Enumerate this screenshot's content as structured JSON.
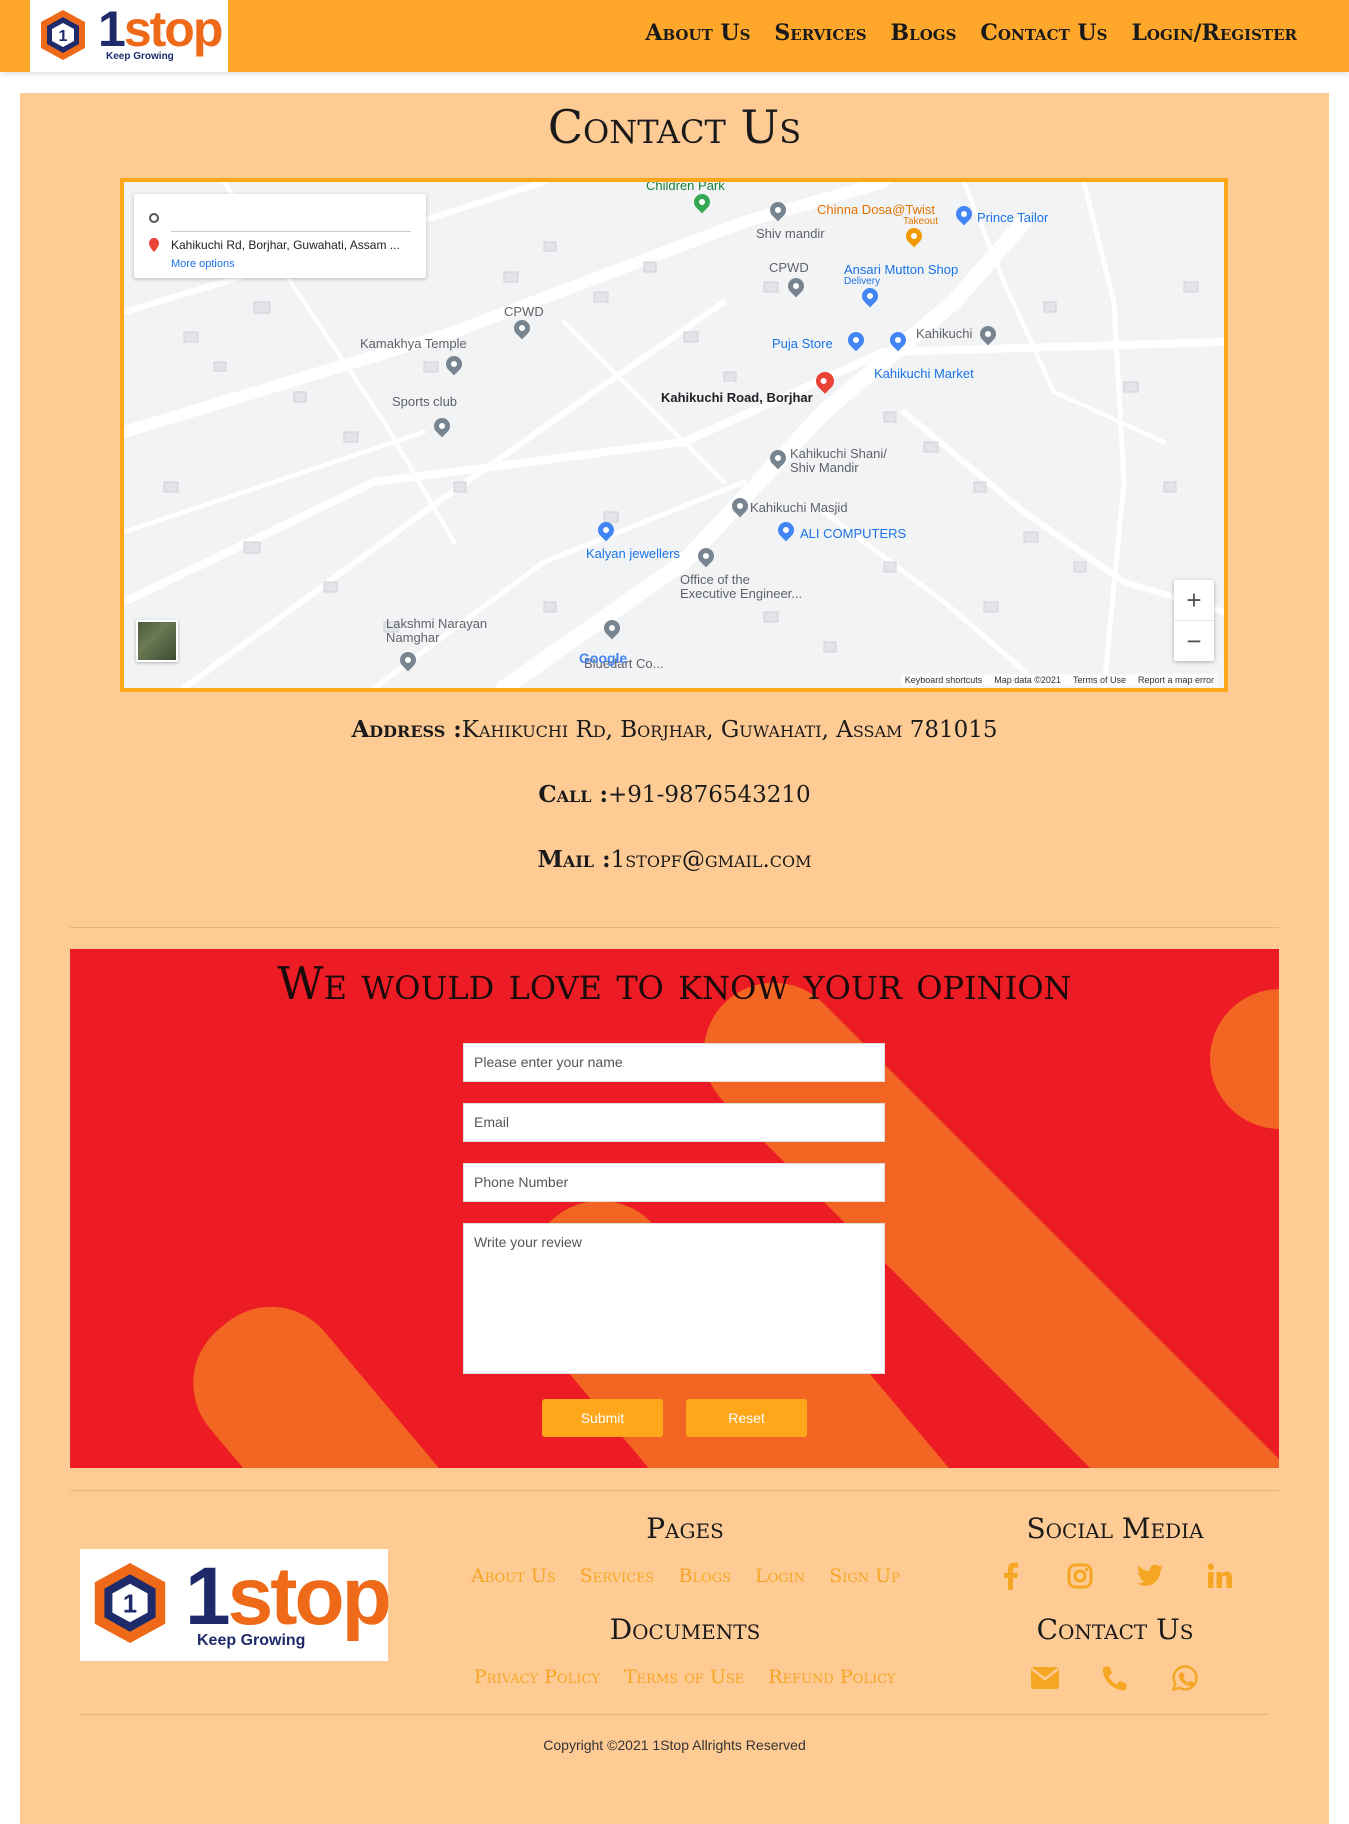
{
  "header": {
    "logo_text": "1stop",
    "logo_tagline": "Keep Growing",
    "nav": [
      "About Us",
      "Services",
      "Blogs",
      "Contact Us",
      "Login/Register"
    ]
  },
  "page_title": "Contact Us",
  "map": {
    "card_address": "Kahikuchi Rd, Borjhar, Guwahati, Assam ...",
    "card_more": "More options",
    "pin_label": "Kahikuchi Road, Borjhar",
    "places": [
      "Children Park",
      "Shiv mandir",
      "Chinna Dosa@Twist",
      "Takeout",
      "Prince Tailor",
      "CPWD",
      "Ansari Mutton Shop",
      "Delivery",
      "CPWD",
      "Kamakhya Temple",
      "Puja Store",
      "Kahikuchi",
      "Kahikuchi Market",
      "Sports club",
      "Kahikuchi Shani/",
      "Shiv Mandir",
      "Kahikuchi Masjid",
      "ALI COMPUTERS",
      "Kalyan jewellers",
      "Office of the",
      "Executive Engineer...",
      "Lakshmi Narayan",
      "Namghar",
      "Bluedart Co..."
    ],
    "google": "Google",
    "footer": [
      "Keyboard shortcuts",
      "Map data ©2021",
      "Terms of Use",
      "Report a map error"
    ],
    "zoom_in": "+",
    "zoom_out": "−"
  },
  "contact": {
    "address_label": "Address :",
    "address": "Kahikuchi Rd, Borjhar, Guwahati, Assam 781015",
    "call_label": "Call :",
    "call": "+91-9876543210",
    "mail_label": "Mail :",
    "mail": "1stopf@gmail.com"
  },
  "opinion": {
    "title": "We would love to know your opinion",
    "name_placeholder": "Please enter your name",
    "email_placeholder": "Email",
    "phone_placeholder": "Phone Number",
    "review_placeholder": "Write your review",
    "submit": "Submit",
    "reset": "Reset"
  },
  "footer": {
    "pages_title": "Pages",
    "pages": [
      "About Us",
      "Services",
      "Blogs",
      "Login",
      "Sign Up"
    ],
    "documents_title": "Documents",
    "documents": [
      "Privacy Policy",
      "Terms of Use",
      "Refund Policy"
    ],
    "social_title": "Social Media",
    "social_icons": [
      "facebook-icon",
      "instagram-icon",
      "twitter-icon",
      "linkedin-icon"
    ],
    "contact_title": "Contact Us",
    "contact_icons": [
      "mail-icon",
      "phone-icon",
      "whatsapp-icon"
    ],
    "copyright": "Copyright ©2021 1Stop Allrights Reserved"
  },
  "colors": {
    "header": "#ffa72a",
    "panel": "#ffcb95",
    "opinion_bg": "#ed1c24",
    "accent": "#ffa61a",
    "logo_orange": "#ef6a18",
    "logo_navy": "#1e2a6a"
  }
}
